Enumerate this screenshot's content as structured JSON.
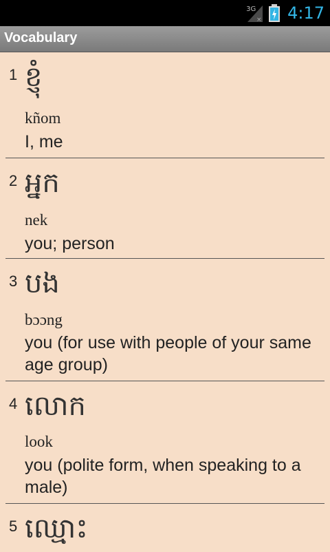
{
  "status_bar": {
    "network": "3G",
    "time": "4:17"
  },
  "title_bar": {
    "title": "Vocabulary"
  },
  "vocabulary": [
    {
      "number": "1",
      "khmer": "ខ្ញុំ",
      "romanization": "kñom",
      "gloss": "I, me"
    },
    {
      "number": "2",
      "khmer": "អ្នក",
      "romanization": "nek",
      "gloss": "you; person"
    },
    {
      "number": "3",
      "khmer": "បង",
      "romanization": "bɔɔng",
      "gloss": "you (for use with people of your same age group)"
    },
    {
      "number": "4",
      "khmer": "លោក",
      "romanization": "look",
      "gloss": "you (polite form, when speaking to a male)"
    },
    {
      "number": "5",
      "khmer": "ឈ្មោះ",
      "romanization": "",
      "gloss": ""
    }
  ]
}
